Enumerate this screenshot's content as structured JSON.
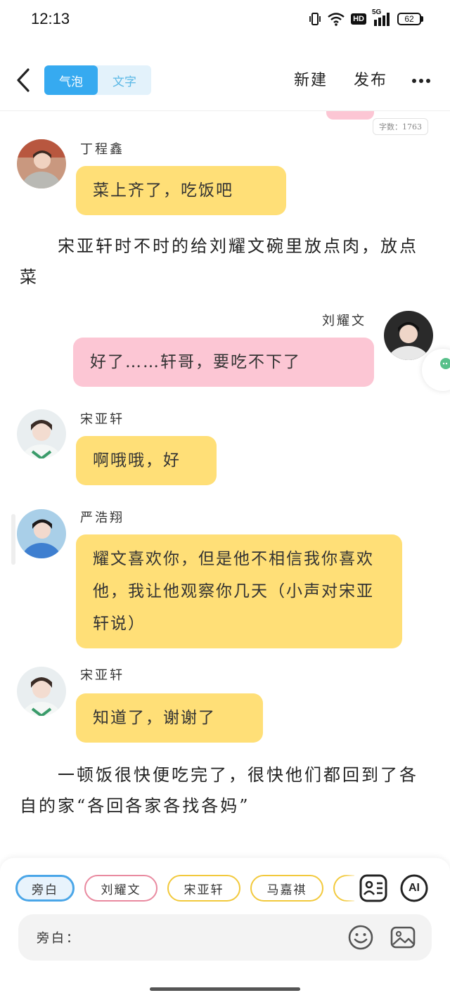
{
  "status_bar": {
    "time": "12:13",
    "hd": "HD",
    "network": "5G",
    "battery": "62"
  },
  "nav": {
    "mode_bubble": "气泡",
    "mode_text": "文字",
    "new_label": "新建",
    "publish_label": "发布"
  },
  "word_count": "字数：1763",
  "messages": [
    {
      "speaker": "丁程鑫",
      "text": "菜上齐了，吃饭吧"
    },
    {
      "narration": "　　宋亚轩时不时的给刘耀文碗里放点肉，放点菜"
    },
    {
      "speaker": "刘耀文",
      "text": "好了……轩哥，要吃不下了"
    },
    {
      "speaker": "宋亚轩",
      "text": "啊哦哦，好"
    },
    {
      "speaker": "严浩翔",
      "text": "耀文喜欢你，但是他不相信我你喜欢他，我让他观察你几天（小声对宋亚轩说）"
    },
    {
      "speaker": "宋亚轩",
      "text": "知道了，谢谢了"
    },
    {
      "narration": "　　一顿饭很快便吃完了，很快他们都回到了各自的家“各回各家各找各妈”"
    }
  ],
  "roles": [
    "旁白",
    "刘耀文",
    "宋亚轩",
    "马嘉祺"
  ],
  "tools": {
    "ai_label": "AI"
  },
  "input": {
    "prefix": "旁白：",
    "placeholder": ""
  },
  "colors": {
    "accent_blue": "#36aaf0",
    "bubble_yellow": "#ffdf77",
    "bubble_pink": "#fcc6d4",
    "chip_pink": "#e98aa0",
    "chip_yellow": "#f2c93c"
  },
  "icons": [
    "back-arrow-icon",
    "more-icon",
    "contacts-icon",
    "ai-icon",
    "emoji-icon",
    "image-icon",
    "wifi-icon",
    "signal-icon",
    "battery-icon",
    "vibrate-icon"
  ]
}
